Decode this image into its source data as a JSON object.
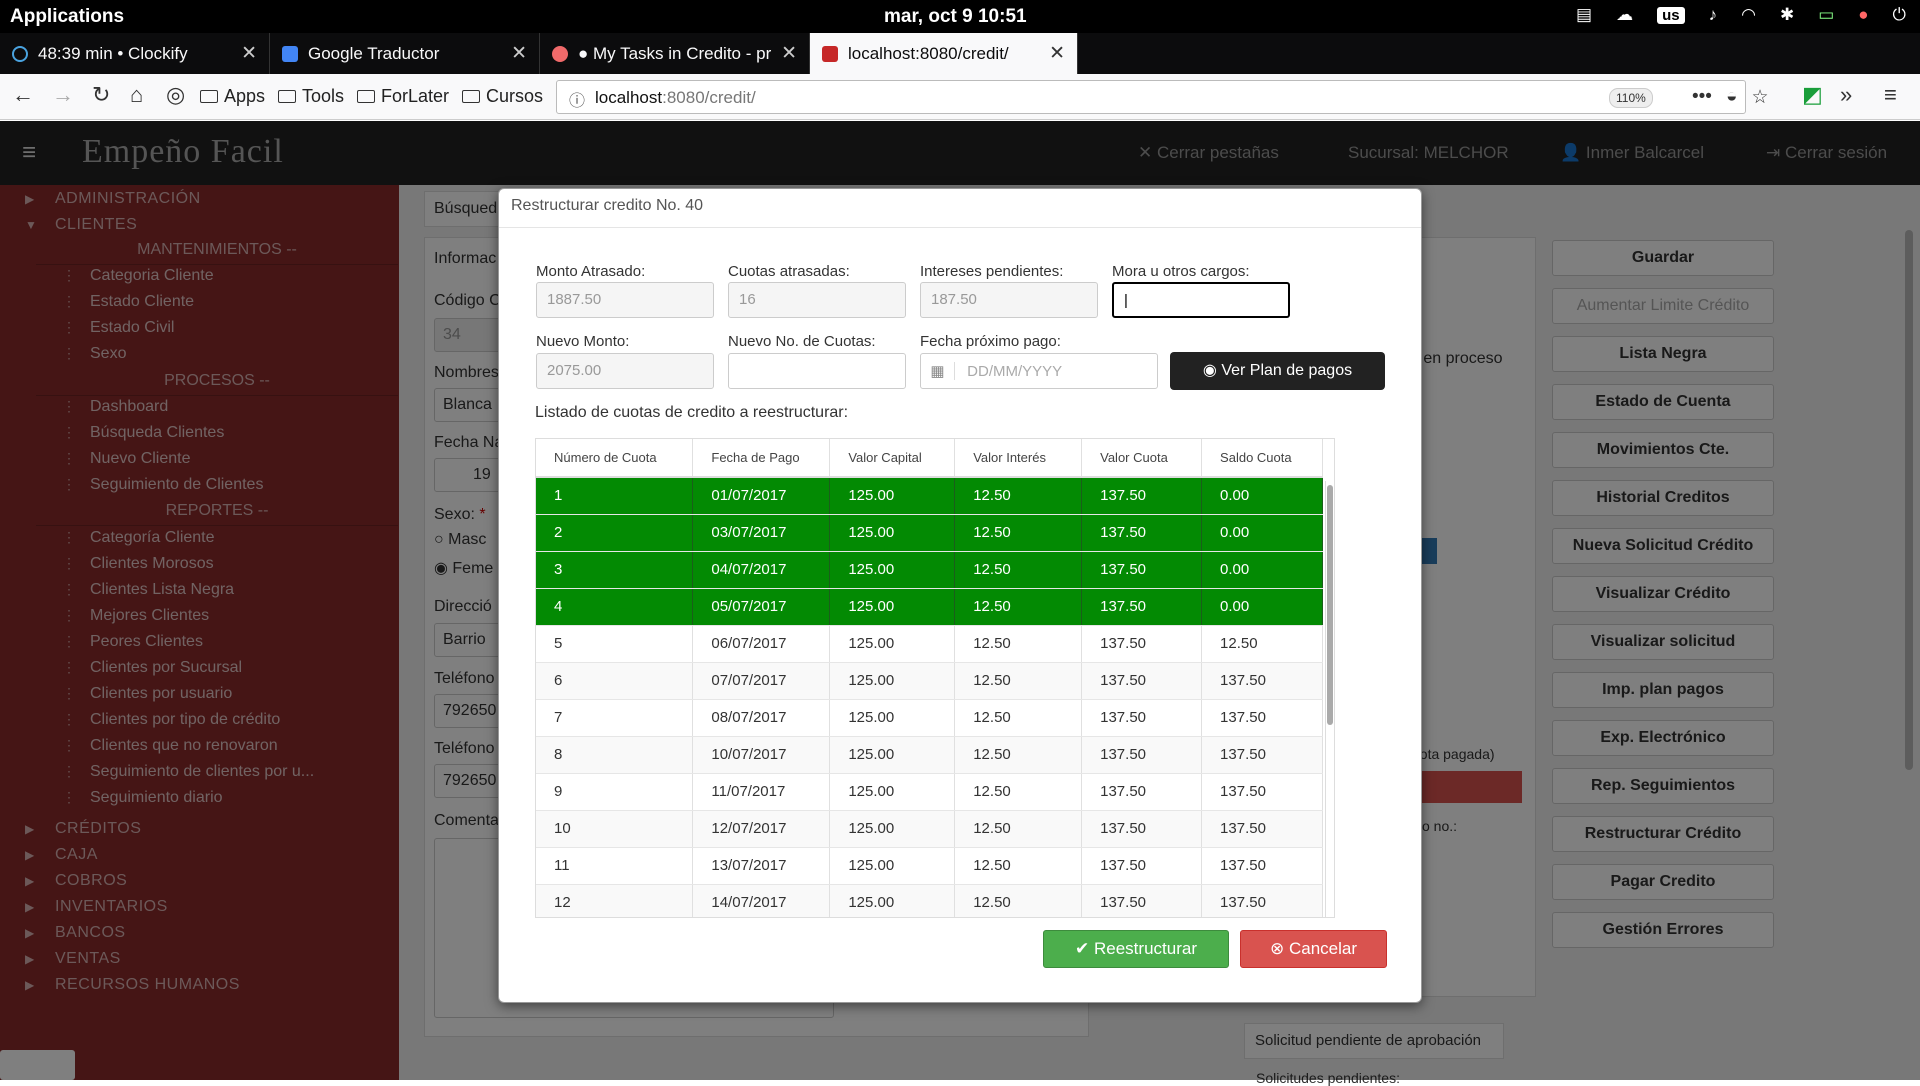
{
  "system": {
    "apps": "Applications",
    "clock": "mar, oct 9  10:51",
    "keyboard": "us"
  },
  "browser": {
    "tabs": [
      {
        "title": "48:39 min • Clockify"
      },
      {
        "title": "Google Traductor"
      },
      {
        "title": "● My Tasks in Credito - pr"
      },
      {
        "title": "localhost:8080/credit/"
      }
    ],
    "bookmarks": [
      "Apps",
      "Tools",
      "ForLater",
      "Cursos"
    ],
    "url_host": "localhost",
    "url_rest": ":8080/credit/",
    "zoom": "110%"
  },
  "app": {
    "brand": "Empeño Facil",
    "header": {
      "close_tabs": "Cerrar pestañas",
      "branch": "Sucursal: MELCHOR",
      "user": "Inmer Balcarcel",
      "logout": "Cerrar sesión"
    }
  },
  "sidebar": {
    "admin": "ADMINISTRACIÓN",
    "clientes": "CLIENTES",
    "sec_mant": "MANTENIMIENTOS --",
    "mant": [
      "Categoria Cliente",
      "Estado Cliente",
      "Estado Civil",
      "Sexo"
    ],
    "sec_proc": "PROCESOS --",
    "proc": [
      "Dashboard",
      "Búsqueda Clientes",
      "Nuevo Cliente",
      "Seguimiento de Clientes"
    ],
    "sec_rep": "REPORTES --",
    "rep": [
      "Categoría Cliente",
      "Clientes Morosos",
      "Clientes Lista Negra",
      "Mejores Clientes",
      "Peores Clientes",
      "Clientes por Sucursal",
      "Clientes por usuario",
      "Clientes por tipo de crédito",
      "Clientes que no renovaron",
      "Seguimiento de clientes por u...",
      "Seguimiento diario"
    ],
    "bottom": [
      "CRÉDITOS",
      "CAJA",
      "COBROS",
      "INVENTARIOS",
      "BANCOS",
      "VENTAS",
      "RECURSOS HUMANOS"
    ]
  },
  "background": {
    "tab_busq": "Búsqued",
    "info": "Informac",
    "codigo": "Código C",
    "codigo_val": "34",
    "nombres": "Nombres",
    "nombres_val": "Blanca",
    "fecha": "Fecha Na",
    "fecha_val": "19",
    "sexo": "Sexo:",
    "sexo_req": "*",
    "masc": "Masc",
    "fem": "Feme",
    "direccion": "Direcció",
    "dir_val": "Barrio",
    "tel1": "Teléfono",
    "tel1_val": "792650",
    "tel2": "Teléfono",
    "tel2_val": "792650",
    "coment": "Comenta",
    "en_proceso": "os en proceso",
    "cuota_pagada": "uota pagada)",
    "pago_no": "o no.:",
    "solicitud": "Solicitud pendiente de aprobación",
    "solicitudes": "Solicitudes pendientes:",
    "buttons": [
      "Guardar",
      "Aumentar Limite Crédito",
      "Lista Negra",
      "Estado de Cuenta",
      "Movimientos Cte.",
      "Historial Creditos",
      "Nueva Solicitud Crédito",
      "Visualizar Crédito",
      "Visualizar solicitud",
      "Imp. plan pagos",
      "Exp. Electrónico",
      "Rep. Seguimientos",
      "Restructurar Crédito",
      "Pagar Credito",
      "Gestión Errores"
    ]
  },
  "modal": {
    "title": "Restructurar credito No. 40",
    "monto_atrasado_label": "Monto Atrasado:",
    "monto_atrasado": "1887.50",
    "cuotas_atrasadas_label": "Cuotas atrasadas:",
    "cuotas_atrasadas": "16",
    "intereses_label": "Intereses pendientes:",
    "intereses": "187.50",
    "mora_label": "Mora u otros cargos:",
    "mora": "",
    "nuevo_monto_label": "Nuevo Monto:",
    "nuevo_monto": "2075.00",
    "nuevo_cuotas_label": "Nuevo No. de Cuotas:",
    "nuevo_cuotas": "",
    "fecha_label": "Fecha próximo pago:",
    "fecha_placeholder": "DD/MM/YYYY",
    "plan_button": "Ver Plan de pagos",
    "list_label": "Listado de cuotas de credito a reestructurar:",
    "columns": [
      "Número de Cuota",
      "Fecha de Pago",
      "Valor Capital",
      "Valor Interés",
      "Valor Cuota",
      "Saldo Cuota"
    ],
    "rows": [
      {
        "n": "1",
        "fecha": "01/07/2017",
        "capital": "125.00",
        "interes": "12.50",
        "cuota": "137.50",
        "saldo": "0.00",
        "paid": true
      },
      {
        "n": "2",
        "fecha": "03/07/2017",
        "capital": "125.00",
        "interes": "12.50",
        "cuota": "137.50",
        "saldo": "0.00",
        "paid": true
      },
      {
        "n": "3",
        "fecha": "04/07/2017",
        "capital": "125.00",
        "interes": "12.50",
        "cuota": "137.50",
        "saldo": "0.00",
        "paid": true
      },
      {
        "n": "4",
        "fecha": "05/07/2017",
        "capital": "125.00",
        "interes": "12.50",
        "cuota": "137.50",
        "saldo": "0.00",
        "paid": true
      },
      {
        "n": "5",
        "fecha": "06/07/2017",
        "capital": "125.00",
        "interes": "12.50",
        "cuota": "137.50",
        "saldo": "12.50",
        "paid": false
      },
      {
        "n": "6",
        "fecha": "07/07/2017",
        "capital": "125.00",
        "interes": "12.50",
        "cuota": "137.50",
        "saldo": "137.50",
        "paid": false
      },
      {
        "n": "7",
        "fecha": "08/07/2017",
        "capital": "125.00",
        "interes": "12.50",
        "cuota": "137.50",
        "saldo": "137.50",
        "paid": false
      },
      {
        "n": "8",
        "fecha": "10/07/2017",
        "capital": "125.00",
        "interes": "12.50",
        "cuota": "137.50",
        "saldo": "137.50",
        "paid": false
      },
      {
        "n": "9",
        "fecha": "11/07/2017",
        "capital": "125.00",
        "interes": "12.50",
        "cuota": "137.50",
        "saldo": "137.50",
        "paid": false
      },
      {
        "n": "10",
        "fecha": "12/07/2017",
        "capital": "125.00",
        "interes": "12.50",
        "cuota": "137.50",
        "saldo": "137.50",
        "paid": false
      },
      {
        "n": "11",
        "fecha": "13/07/2017",
        "capital": "125.00",
        "interes": "12.50",
        "cuota": "137.50",
        "saldo": "137.50",
        "paid": false
      },
      {
        "n": "12",
        "fecha": "14/07/2017",
        "capital": "125.00",
        "interes": "12.50",
        "cuota": "137.50",
        "saldo": "137.50",
        "paid": false
      }
    ],
    "btn_restructure": "Reestructurar",
    "btn_cancel": "Cancelar"
  },
  "colors": {
    "paid_row": "#038a03",
    "sidebar": "#8b2b2b",
    "success": "#4cae4c",
    "danger": "#d9534f"
  }
}
